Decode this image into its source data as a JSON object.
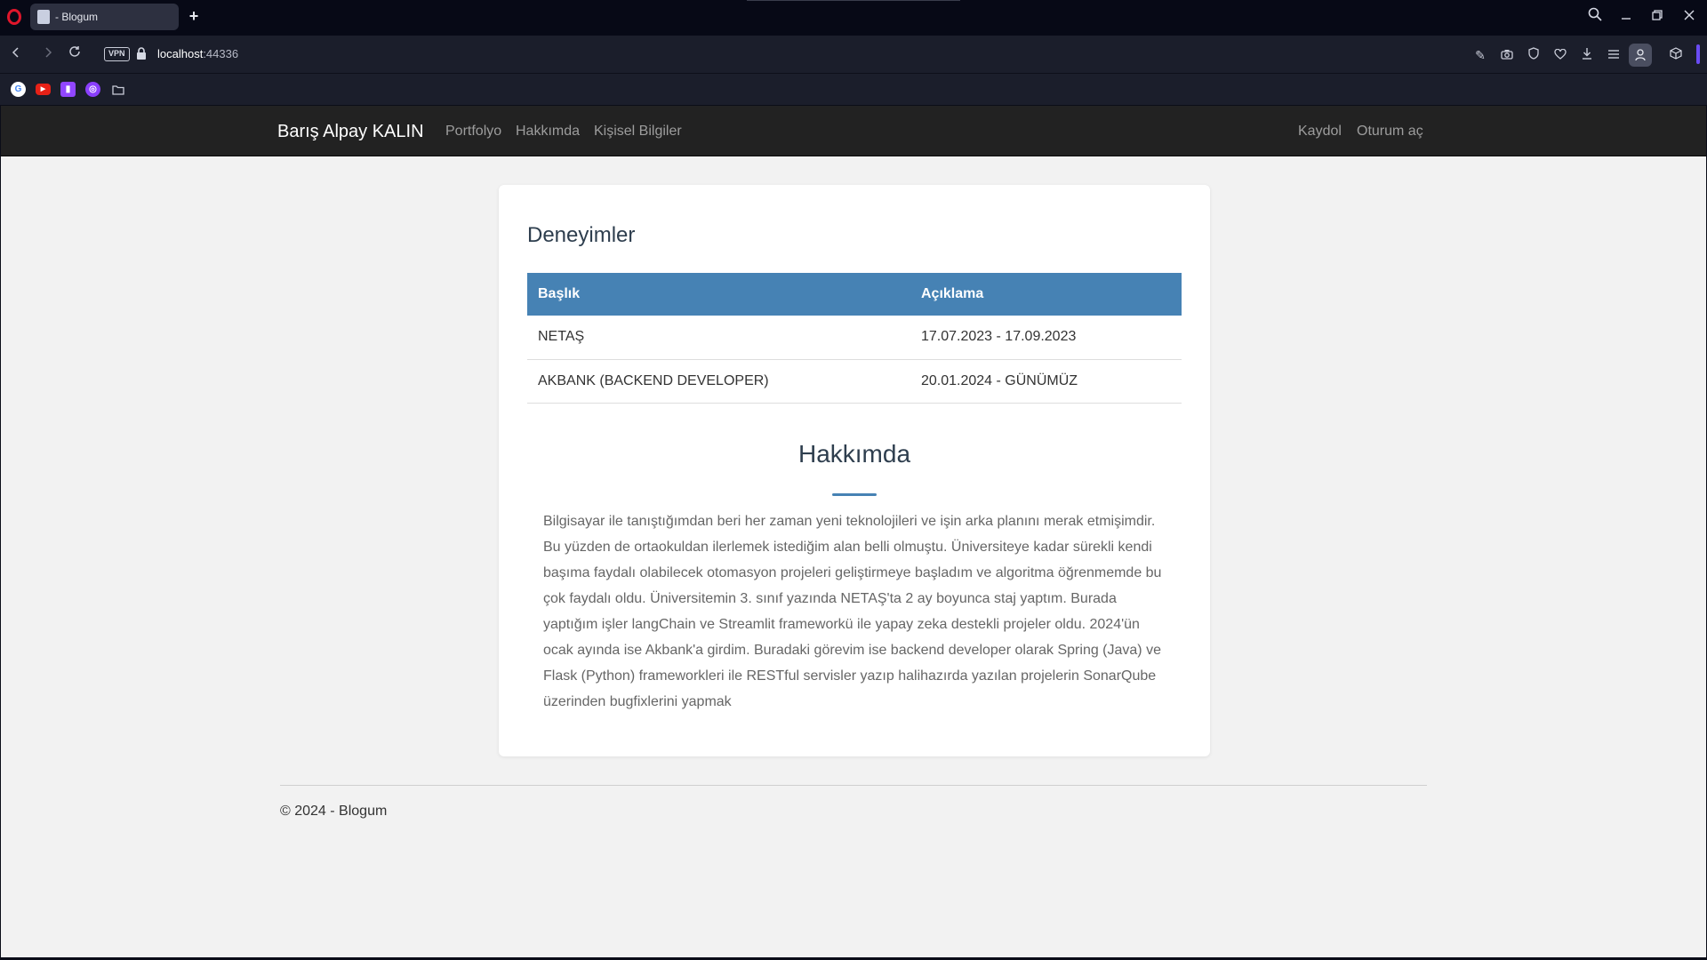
{
  "browser": {
    "tab_title": "- Blogum",
    "new_tab_symbol": "+",
    "vpn_label": "VPN",
    "url_host": "localhost",
    "url_port": ":44336",
    "bookmarks": [
      {
        "icon": "google-icon",
        "color": "#ffffff"
      },
      {
        "icon": "youtube-icon",
        "color": "#e62117"
      },
      {
        "icon": "twitch-icon",
        "color": "#9146ff"
      },
      {
        "icon": "extension-icon",
        "color": "#8a3ffc"
      },
      {
        "icon": "folder-icon",
        "color": "#c9ccd8"
      }
    ]
  },
  "site": {
    "brand": "Barış Alpay KALIN",
    "nav": {
      "portfolio": "Portfolyo",
      "about": "Hakkımda",
      "personal": "Kişisel Bilgiler",
      "register": "Kaydol",
      "login": "Oturum aç"
    },
    "experience": {
      "title": "Deneyimler",
      "headers": {
        "title": "Başlık",
        "description": "Açıklama"
      },
      "rows": [
        {
          "title": "NETAŞ",
          "description": "17.07.2023 - 17.09.2023"
        },
        {
          "title": "AKBANK (BACKEND DEVELOPER)",
          "description": "20.01.2024 - GÜNÜMÜZ"
        }
      ]
    },
    "about": {
      "title": "Hakkımda",
      "text": "Bilgisayar ile tanıştığımdan beri her zaman yeni teknolojileri ve işin arka planını merak etmişimdir. Bu yüzden de ortaokuldan ilerlemek istediğim alan belli olmuştu. Üniversiteye kadar sürekli kendi başıma faydalı olabilecek otomasyon projeleri geliştirmeye başladım ve algoritma öğrenmemde bu çok faydalı oldu. Üniversitemin 3. sınıf yazında NETAŞ'ta 2 ay boyunca staj yaptım. Burada yaptığım işler langChain ve Streamlit frameworkü ile yapay zeka destekli projeler oldu. 2024'ün ocak ayında ise Akbank'a girdim. Buradaki görevim ise backend developer olarak Spring (Java) ve Flask (Python) frameworkleri ile RESTful servisler yazıp halihazırda yazılan projelerin SonarQube üzerinden bugfixlerini yapmak"
    },
    "footer": "© 2024 - Blogum"
  },
  "colors": {
    "accent": "#4682b4",
    "navbar": "#222222",
    "page_bg": "#f2f2f2"
  }
}
